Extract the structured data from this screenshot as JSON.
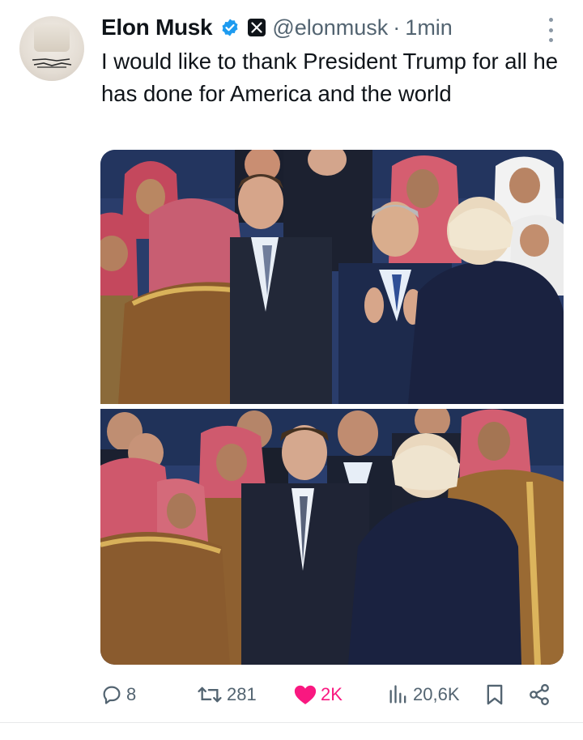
{
  "tweet": {
    "author": {
      "name": "Elon Musk",
      "handle": "@elonmusk",
      "verified": true,
      "affiliate_badge": "x-logo-icon",
      "avatar": "profile-avatar"
    },
    "separator": "·",
    "time": "1min",
    "text": "I would like to thank President Trump for all he has done for America and the world",
    "media": [
      {
        "name": "photo-1"
      },
      {
        "name": "photo-2"
      }
    ],
    "stats": {
      "replies": "8",
      "reposts": "281",
      "likes": "2K",
      "views": "20,6K"
    },
    "icons": {
      "reply": "reply-icon",
      "repost": "repost-icon",
      "like": "heart-icon",
      "views": "views-icon",
      "bookmark": "bookmark-icon",
      "share": "share-icon",
      "more": "more-icon"
    }
  },
  "colors": {
    "text": "#0f1419",
    "secondary": "#536471",
    "verified": "#1d9bf0",
    "like": "#f91880",
    "divider": "#e7e9ea"
  }
}
